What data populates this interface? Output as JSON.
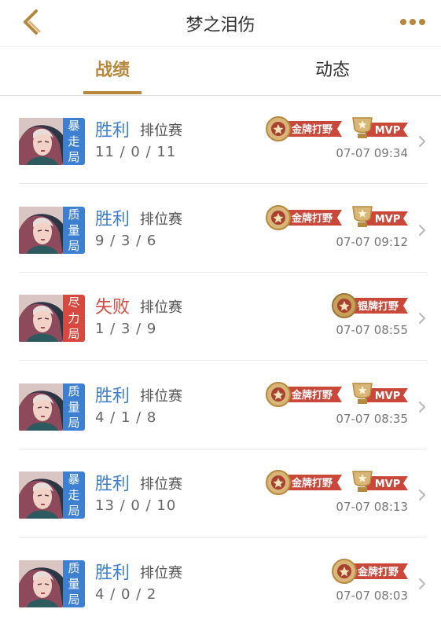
{
  "header": {
    "title": "梦之泪伤"
  },
  "tabs": [
    {
      "label": "战绩",
      "active": true
    },
    {
      "label": "动态",
      "active": false
    }
  ],
  "colors": {
    "accent": "#b6873c",
    "win": "#3d7fd0",
    "lose": "#d7493e"
  },
  "matches": [
    {
      "tag": "暴走局",
      "tag_color": "blue",
      "result": "胜利",
      "result_type": "win",
      "mode": "排位赛",
      "kda": "11 / 0 / 11",
      "medal": "金牌打野",
      "mvp": true,
      "time": "07-07 09:34"
    },
    {
      "tag": "质量局",
      "tag_color": "blue",
      "result": "胜利",
      "result_type": "win",
      "mode": "排位赛",
      "kda": "9 / 3 / 6",
      "medal": "金牌打野",
      "mvp": true,
      "time": "07-07 09:12"
    },
    {
      "tag": "尽力局",
      "tag_color": "red",
      "result": "失败",
      "result_type": "lose",
      "mode": "排位赛",
      "kda": "1 / 3 / 9",
      "medal": "银牌打野",
      "mvp": false,
      "time": "07-07 08:55"
    },
    {
      "tag": "质量局",
      "tag_color": "blue",
      "result": "胜利",
      "result_type": "win",
      "mode": "排位赛",
      "kda": "4 / 1 / 8",
      "medal": "金牌打野",
      "mvp": true,
      "time": "07-07 08:35"
    },
    {
      "tag": "暴走局",
      "tag_color": "blue",
      "result": "胜利",
      "result_type": "win",
      "mode": "排位赛",
      "kda": "13 / 0 / 10",
      "medal": "金牌打野",
      "mvp": true,
      "time": "07-07 08:13"
    },
    {
      "tag": "质量局",
      "tag_color": "blue",
      "result": "胜利",
      "result_type": "win",
      "mode": "排位赛",
      "kda": "4 / 0 / 2",
      "medal": "金牌打野",
      "mvp": false,
      "time": "07-07 08:03"
    }
  ],
  "badge_labels": {
    "mvp": "MVP"
  }
}
